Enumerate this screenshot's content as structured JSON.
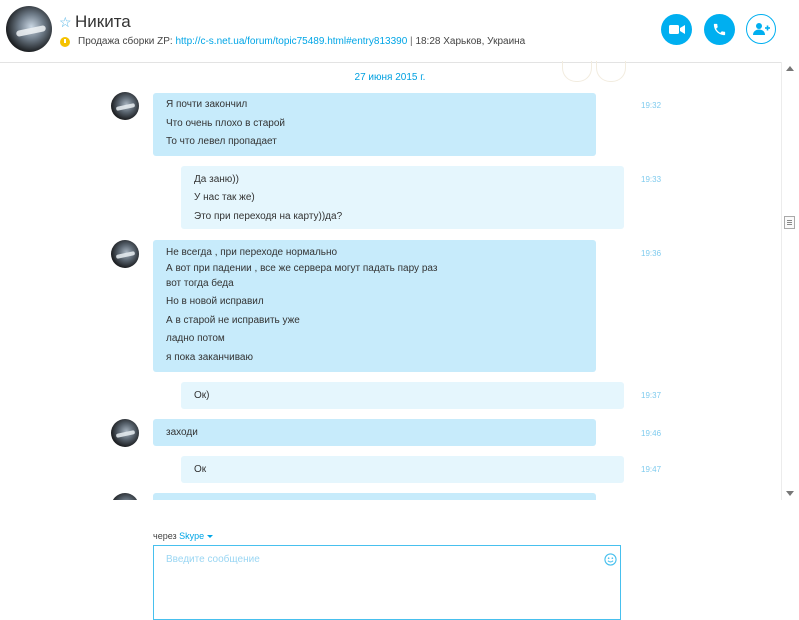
{
  "header": {
    "contact_name": "Никита",
    "mood_prefix": "Продажа сборки ZP:",
    "mood_link": "http://c-s.net.ua/forum/topic75489.html#entry813390",
    "mood_separator": "|",
    "local_time_location": "18:28 Харьков, Украина"
  },
  "chat": {
    "date": "27 июня 2015 г.",
    "messages": [
      {
        "from": "them",
        "time": "19:32",
        "lines": [
          "Я почти закончил",
          "Что очень плохо в старой",
          "То что левел пропадает"
        ]
      },
      {
        "from": "me",
        "time": "19:33",
        "lines": [
          "Да заню))",
          "У нас так же)",
          "Это при переходя на карту))да?"
        ]
      },
      {
        "from": "them",
        "time": "19:36",
        "lines": [
          "Не всегда , при переходе нормально",
          "А вот при падении , все же сервера могут падать пару раз",
          "вот тогда беда",
          "Но в новой исправил",
          "А в старой не исправить уже",
          "ладно потом",
          "я пока заканчиваю"
        ]
      },
      {
        "from": "me",
        "time": "19:37",
        "lines": [
          "Ок)"
        ]
      },
      {
        "from": "them",
        "time": "19:46",
        "lines": [
          "заходи"
        ]
      },
      {
        "from": "me",
        "time": "19:47",
        "lines": [
          "Ок"
        ]
      }
    ]
  },
  "compose": {
    "via_label": "через",
    "via_service": "Skype",
    "placeholder": "Введите сообщение"
  },
  "colors": {
    "accent": "#00aff0",
    "bubble_them": "#c7ebfb",
    "bubble_me": "#e5f6fd"
  },
  "icons": {
    "favorite": "star-outline-icon",
    "status": "away-clock-icon",
    "video": "video-camera-icon",
    "call": "phone-icon",
    "add": "add-contact-icon",
    "emoticon": "smiley-icon"
  }
}
